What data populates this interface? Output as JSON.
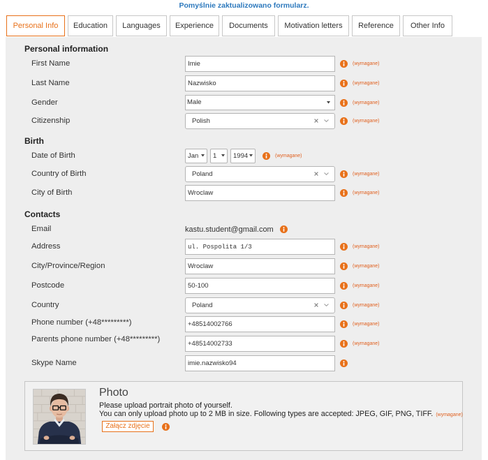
{
  "status_message": "Pomyślnie zaktualizowano formularz.",
  "colors": {
    "accent": "#e8711a",
    "required_text": "#e0601f",
    "status_text": "#2d79bd",
    "panel_bg": "#eeeeee",
    "photo_box_bg": "#f1f1f1"
  },
  "icons": {
    "info": "info-icon",
    "clear": "clear-icon",
    "select2_arrow": "chevron-down-icon",
    "select_arrow": "caret-down-icon"
  },
  "tabs": [
    {
      "label": "Personal Info",
      "active": true
    },
    {
      "label": "Education",
      "active": false
    },
    {
      "label": "Languages",
      "active": false
    },
    {
      "label": "Experience",
      "active": false
    },
    {
      "label": "Documents",
      "active": false
    },
    {
      "label": "Motivation letters",
      "active": false
    },
    {
      "label": "Reference",
      "active": false
    },
    {
      "label": "Other Info",
      "active": false
    }
  ],
  "required_label": "(wymagane)",
  "personal": {
    "title": "Personal information",
    "first_name": {
      "label": "First Name",
      "value": "Imie"
    },
    "last_name": {
      "label": "Last Name",
      "value": "Nazwisko"
    },
    "gender": {
      "label": "Gender",
      "value": "Male"
    },
    "citizenship": {
      "label": "Citizenship",
      "value": "Polish"
    }
  },
  "birth": {
    "title": "Birth",
    "date_of_birth": {
      "label": "Date of Birth",
      "month": "Jan",
      "day": "1",
      "year": "1994"
    },
    "country": {
      "label": "Country of Birth",
      "value": "Poland"
    },
    "city": {
      "label": "City of Birth",
      "value": "Wroclaw"
    }
  },
  "contacts": {
    "title": "Contacts",
    "email": {
      "label": "Email",
      "value": "kastu.student@gmail.com"
    },
    "address": {
      "label": "Address",
      "value": "ul. Pospolita 1/3"
    },
    "city": {
      "label": "City/Province/Region",
      "value": "Wroclaw"
    },
    "postcode": {
      "label": "Postcode",
      "value": "50-100"
    },
    "country": {
      "label": "Country",
      "value": "Poland"
    },
    "phone": {
      "label": "Phone number (+48*********)",
      "value": "+48514002766"
    },
    "parents_phone": {
      "label": "Parents phone number (+48*********)",
      "value": "+48514002733"
    },
    "skype": {
      "label": "Skype Name",
      "value": "imie.nazwisko94"
    }
  },
  "photo": {
    "title": "Photo",
    "instruction": "Please upload portrait photo of yourself.",
    "size_note": "You can only upload photo up to 2 MB in size. Following types are accepted: JPEG, GIF, PNG, TIFF.",
    "upload_button": "Załącz zdjęcie"
  }
}
